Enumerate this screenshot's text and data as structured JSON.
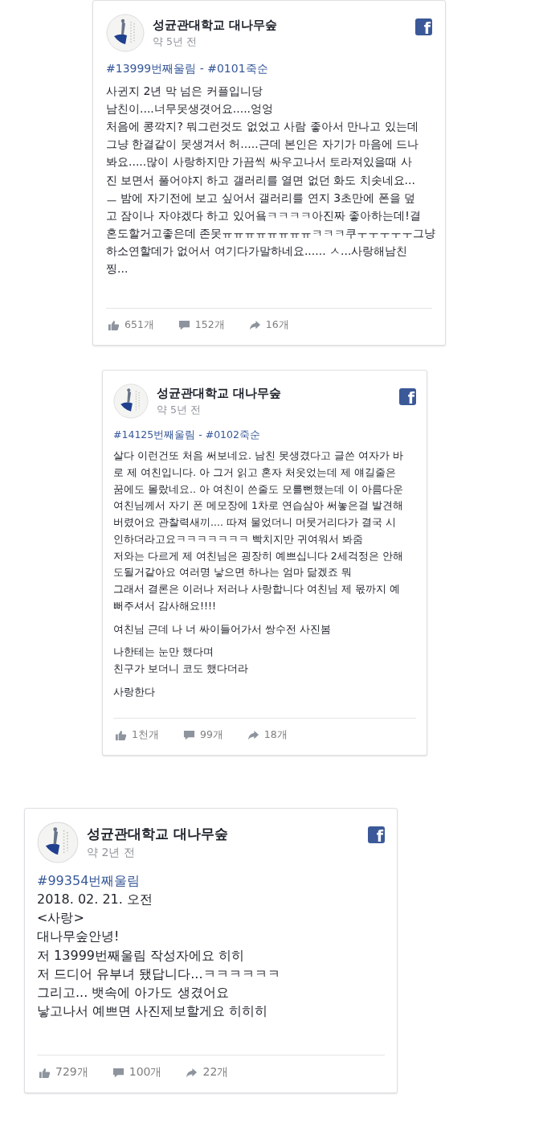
{
  "posts": [
    {
      "page_name": "성균관대학교 대나무숲",
      "time": "약 5년 전",
      "logo": "f",
      "hashtag": "#13999번째울림 - #0101죽순",
      "paragraphs": [
        [
          "사귄지 2년 막 넘은 커플입니당",
          "남친이....너무못생겻어요.....엉엉",
          "처음에 콩깍지? 뭐그런것도 없었고 사람 좋아서 만나고 있는데",
          "그냥 한결같이 못생겨서 허.....근데 본인은 자기가 마음에 드나",
          "봐요.....많이 사랑하지만 가끔씩 싸우고나서 토라져있을때 사",
          "진 보면서 풀어야지 하고 갤러리를 열면 없던 화도 치솟네요...",
          "ㅡ 밤에 자기전에 보고 싶어서 갤러리를 연지 3초만에 폰을 덮",
          "고 잠이나 자야겠다 하고 있어욬ㅋㅋㅋㅋ아진짜 좋아하는데!결",
          "혼도할거고좋은데 존못ㅠㅠㅠㅠㅠㅠㅠㅠㅋㅋㅋ쿠ㅜㅜㅜㅜㅜ그냥",
          "하소연할데가 없어서 여기다가말하네요...... ㅅ...사랑해남친",
          "찡..."
        ]
      ],
      "likes": "651개",
      "comments": "152개",
      "shares": "16개"
    },
    {
      "page_name": "성균관대학교 대나무숲",
      "time": "약 5년 전",
      "logo": "f",
      "hashtag": "#14125번째울림 - #0102죽순",
      "paragraphs": [
        [
          "살다 이런건또 처음 써보네요. 남친 못생겼다고 글쓴 여자가 바",
          "로 제 여친입니다. 아 그거 읽고 혼자 처웃었는데 제 얘길줄은",
          "꿈에도 몰랐네요.. 아 여친이 쓴줄도 모를뻔했는데 이 아름다운",
          "여친님께서 자기 폰 메모장에 1차로 연습삼아 써놓은걸 발견해",
          "버렸어요 관찰력새끼.... 따져 물었더니 머뭇거리다가 결국 시",
          "인하더라고요ㅋㅋㅋㅋㅋㅋㅋ 빡치지만 귀여워서 봐줌",
          "저와는 다르게 제 여친님은 굉장히 예쁘십니다 2세걱정은 안해",
          "도될거같아요 여러명 낳으면 하나는 엄마 닮겠죠 뭐",
          "그래서 결론은 이러나 저러나 사랑합니다 여친님 제 몫까지 예",
          "뻐주셔서 감사해요!!!!"
        ],
        [
          "여친님 근데 나 너 싸이들어가서 쌍수전 사진봄"
        ],
        [
          "나한테는 눈만 했다며",
          "친구가 보더니 코도 했다더라"
        ],
        [
          "사랑한다"
        ]
      ],
      "likes": "1천개",
      "comments": "99개",
      "shares": "18개"
    },
    {
      "page_name": "성균관대학교 대나무숲",
      "time": "약 2년 전",
      "logo": "f",
      "hashtag": "#99354번째울림",
      "paragraphs": [
        [
          "2018. 02. 21. 오전",
          "<사랑>",
          "대나무숲안녕!",
          "저 13999번째울림 작성자에요 히히",
          "저 드디어 유부녀 됐답니다...ㅋㅋㅋㅋㅋㅋ",
          "그리고... 뱃속에 아가도 생겼어요",
          "낳고나서 예쁘면 사진제보할게요 히히히"
        ]
      ],
      "likes": "729개",
      "comments": "100개",
      "shares": "22개"
    }
  ]
}
